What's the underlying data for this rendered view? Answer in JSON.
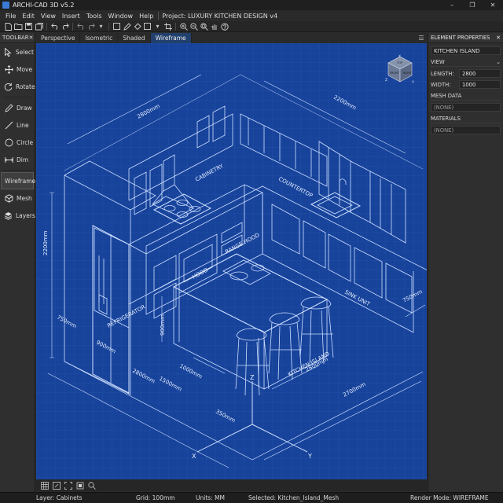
{
  "window": {
    "title": "ARCHI-CAD 3D v5.2",
    "controls": [
      "–",
      "❐",
      "✕"
    ]
  },
  "menu": {
    "items": [
      "File",
      "Edit",
      "View",
      "Insert",
      "Tools",
      "Window",
      "Help"
    ],
    "project": "Project: LUXURY KITCHEN DESIGN v4"
  },
  "toolbox": {
    "title": "TOOLBAR",
    "close": "✕",
    "tools": [
      {
        "label": "Select",
        "icon": "cursor-arrow-icon"
      },
      {
        "label": "Move",
        "icon": "move-arrows-icon"
      },
      {
        "label": "Rotate",
        "icon": "rotate-icon"
      },
      {
        "label": "Draw",
        "icon": "pencil-icon"
      },
      {
        "label": "Line",
        "icon": "line-icon"
      },
      {
        "label": "Circle",
        "icon": "circle-icon"
      },
      {
        "label": "Dim",
        "icon": "dimension-icon"
      },
      {
        "label": "Wireframe",
        "icon": "wireframe-icon"
      },
      {
        "label": "Mesh",
        "icon": "mesh-icon"
      },
      {
        "label": "Layers",
        "icon": "layers-icon"
      }
    ],
    "active_tool": "Wireframe"
  },
  "tabs": {
    "items": [
      "Perspective",
      "Isometric",
      "Shaded",
      "Wireframe"
    ],
    "active": "Wireframe"
  },
  "viewport": {
    "background": "#17439b",
    "line_color": "#cfe0ff",
    "navcube_faces": [
      "TOP",
      "FRONT",
      "RIGHT"
    ],
    "navcube_axes": [
      "Z",
      "X",
      "Y"
    ],
    "labels": {
      "cabinetry": "CABINETRY",
      "countertop": "COUNTERTOP",
      "hood": "HOOD",
      "range_hood": "RANGE HOOD",
      "refrigerator": "REFRIGERATOR",
      "sink_unit": "SINK UNIT",
      "kitchen_island": "KITCHEN ISLAND"
    },
    "dimensions": {
      "top_left": "2800mm",
      "top_right": "2200mm",
      "height_left": "2200mm",
      "island_height": "900mm",
      "island_length": "2800mm",
      "island_width": "1000mm",
      "depth_left": "750mm",
      "base_900": "900mm",
      "base_2800": "2800mm",
      "base_1500": "1500mm",
      "base_350": "350mm",
      "right_2700": "2700mm",
      "right_750": "750mm",
      "axis_z": "Z",
      "axis_x": "X",
      "axis_y": "Y"
    }
  },
  "viewport_toolbar": [
    "grid-icon",
    "snap-icon",
    "fit-view-icon",
    "pan-icon",
    "zoom-icon"
  ],
  "properties": {
    "title": "ELEMENT PROPERTIES",
    "close": "✕",
    "element_name": "KITCHEN ISLAND",
    "view_section": "VIEW",
    "length_label": "LENGTH:",
    "length_value": "2800",
    "width_label": "WIDTH:",
    "width_value": "1000",
    "mesh_section": "MESH DATA",
    "mesh_value": "(NONE)",
    "materials_section": "MATERIALS",
    "materials_value": "(NONE)"
  },
  "status": {
    "layer": "Layer: Cabinets",
    "grid": "Grid: 100mm",
    "units": "Units: MM",
    "selected": "Selected: Kitchen_Island_Mesh",
    "render": "Render Mode: WIREFRAME"
  }
}
